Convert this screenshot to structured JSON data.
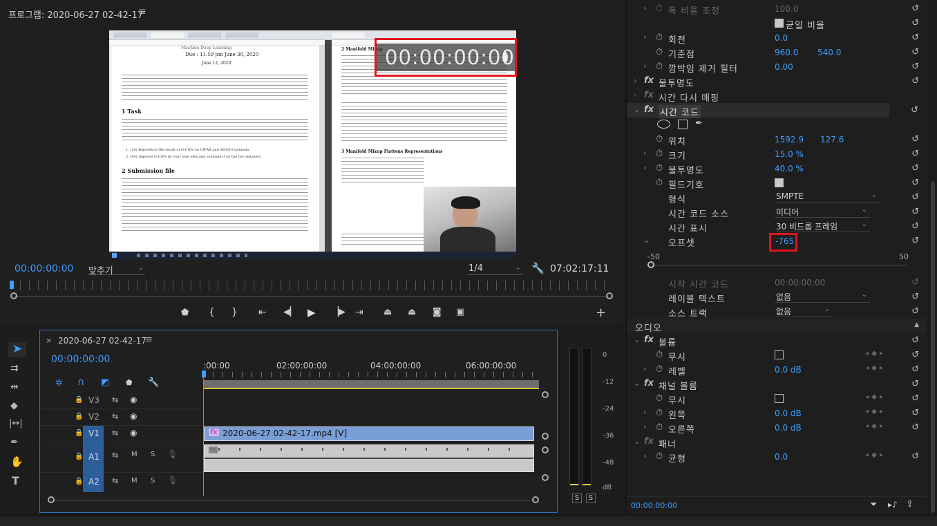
{
  "program": {
    "title": "프로그램: 2020-06-27 02-42-17",
    "menu_glyph": "≡",
    "timecode_overlay": "00:00:00:00",
    "current_time": "00:00:00:00",
    "fit_label": "맞추기",
    "resolution": "1/4",
    "duration": "07:02:17:11"
  },
  "doc": {
    "header_top": "Machine Deep Learning",
    "due": "Due : 11:59 pm June 30, 2020",
    "date": "June 12, 2020",
    "task_heading": "1   Task",
    "submission_heading": "2   Submission file",
    "list1": "1. (20) Reproduce the result of G-CNN on CIFAR and AIG510 datasets.",
    "list2": "2. (80) Improve G-CNN by your own idea and evaluate it on the two datasets.",
    "right_heading1": "2   Manifold Mixup",
    "right_heading2": "3   Manifold Mixup Flattens Representations"
  },
  "timeline": {
    "tab_title": "2020-06-27 02-42-17",
    "current_time": "00:00:00:00",
    "ruler": [
      ":00:00",
      "02:00:00:00",
      "04:00:00:00",
      "06:00:00:00"
    ],
    "tracks": [
      "V3",
      "V2",
      "V1",
      "A1",
      "A2"
    ],
    "clip_video": "2020-06-27 02-42-17.mp4 [V]",
    "fx_badge": "fx"
  },
  "meter": {
    "scale": [
      "0",
      "-12",
      "-24",
      "-36",
      "-48",
      "dB"
    ],
    "solo": [
      "S",
      "S"
    ]
  },
  "effects": {
    "scale_width_label": "폭 비율 조정",
    "scale_width_val": "100.0",
    "uniform_scale": "균일 비율",
    "rotation": "회전",
    "rotation_val": "0.0",
    "anchor": "기준점",
    "anchor_x": "960.0",
    "anchor_y": "540.0",
    "antiflicker": "깜박임 제거 필터",
    "antiflicker_val": "0.00",
    "opacity": "불투명도",
    "timeremap": "시간 다시 매핑",
    "timecode": "시간 코드",
    "position": "위치",
    "position_x": "1592.9",
    "position_y": "127.6",
    "size": "크기",
    "size_val": "15.0 %",
    "tc_opacity": "불투명도",
    "tc_opacity_val": "40.0 %",
    "field": "필드기호",
    "format": "형식",
    "format_val": "SMPTE",
    "source": "시간 코드 소스",
    "source_val": "미디어",
    "display": "시간 표시",
    "display_val": "30 비드롭 프레임",
    "offset": "오프셋",
    "offset_val": "-765",
    "slider_min": "-50",
    "slider_max": "50",
    "start_tc": "시작 시간 코드",
    "start_tc_val": "00:00:00:00",
    "label_text": "레이블 텍스트",
    "label_text_val": "없음",
    "track_src": "소스 트랙",
    "track_src_val": "없음",
    "audio_section": "오디오",
    "volume": "볼륨",
    "bypass": "무시",
    "level": "레벨",
    "level_val": "0.0 dB",
    "channel_volume": "채널 볼륨",
    "bypass2": "무시",
    "left": "왼쪽",
    "left_val": "0.0 dB",
    "right": "오른쪽",
    "right_val": "0.0 dB",
    "panner": "패너",
    "balance": "균형",
    "balance_val": "0.0",
    "footer_time": "00:00:00:00"
  },
  "colors": {
    "accent": "#3f9cff",
    "highlight_box": "#e0141e",
    "timeline_border": "#2d6fc0",
    "clip_video": "#7a9fd6"
  }
}
